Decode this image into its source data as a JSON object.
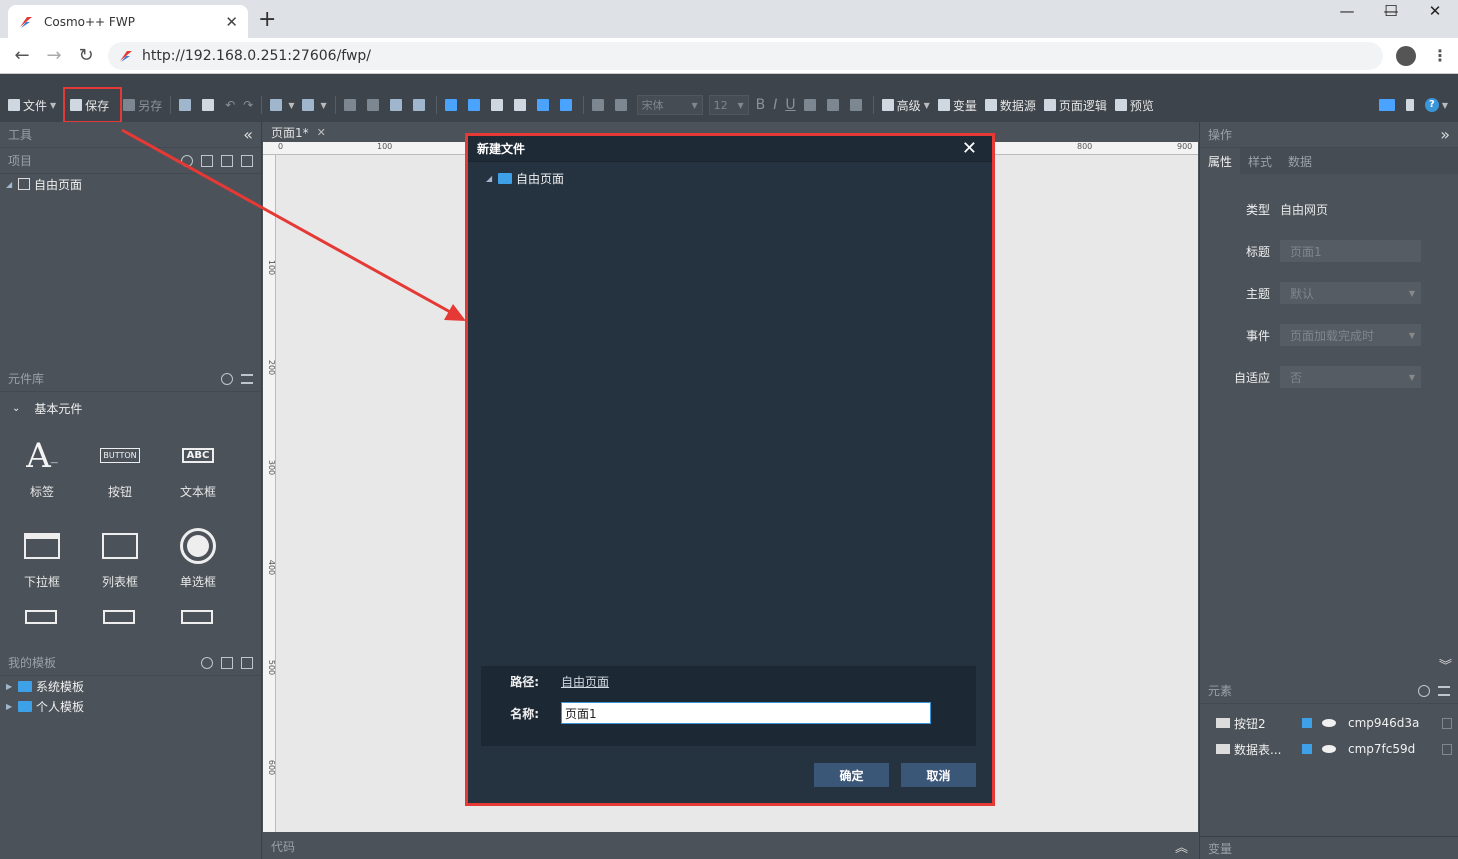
{
  "browser": {
    "tab_title": "Cosmo++ FWP",
    "tab_close": "✕",
    "new_tab": "+",
    "url": "http://192.168.0.251:27606/fwp/",
    "controls": {
      "minimize": "—",
      "maximize": "☐",
      "close": "✕"
    }
  },
  "toolbar": {
    "file": "文件",
    "save": "保存",
    "save_as": "另存",
    "font_family": "宋体",
    "font_size": "12",
    "bold": "B",
    "italic": "I",
    "underline": "U",
    "advanced": "高级",
    "variables": "变量",
    "datasource": "数据源",
    "page_logic": "页面逻辑",
    "preview": "预览",
    "help": "?"
  },
  "left": {
    "tools_title": "工具",
    "collapse": "«",
    "project_title": "项目",
    "project_root": "自由页面",
    "library_title": "元件库",
    "library_category": "基本元件",
    "components": [
      {
        "label": "标签",
        "icon": "label-icon",
        "glyph": "A"
      },
      {
        "label": "按钮",
        "icon": "button-icon",
        "glyph": "BUTTON"
      },
      {
        "label": "文本框",
        "icon": "textbox-icon",
        "glyph": "ABC"
      },
      {
        "label": "下拉框",
        "icon": "dropdown-icon",
        "glyph": ""
      },
      {
        "label": "列表框",
        "icon": "listbox-icon",
        "glyph": ""
      },
      {
        "label": "单选框",
        "icon": "radio-icon",
        "glyph": ""
      }
    ],
    "templates_title": "我的模板",
    "templates": [
      "系统模板",
      "个人模板"
    ]
  },
  "canvas": {
    "doc_tab": "页面1*",
    "doc_close": "✕",
    "ruler_h": [
      "0",
      "100",
      "800",
      "900"
    ],
    "ruler_v": [
      "100",
      "200",
      "300",
      "400",
      "500",
      "600"
    ],
    "code_label": "代码"
  },
  "right": {
    "ops_title": "操作",
    "tabs": [
      "属性",
      "样式",
      "数据"
    ],
    "props": {
      "type_label": "类型",
      "type_value": "自由网页",
      "title_label": "标题",
      "title_value": "页面1",
      "theme_label": "主题",
      "theme_value": "默认",
      "event_label": "事件",
      "event_value": "页面加载完成时",
      "adaptive_label": "自适应",
      "adaptive_value": "否"
    },
    "elements_title": "元素",
    "elements": [
      {
        "name": "按钮2",
        "id": "cmp946d3a"
      },
      {
        "name": "数据表...",
        "id": "cmp7fc59d"
      }
    ],
    "variables_title": "变量"
  },
  "dialog": {
    "title": "新建文件",
    "close": "✕",
    "tree_root": "自由页面",
    "path_label": "路径:",
    "path_value": "自由页面",
    "name_label": "名称:",
    "name_value": "页面1",
    "ok": "确定",
    "cancel": "取消"
  },
  "colors": {
    "highlight": "#e53935",
    "folder": "#3ea0e6",
    "dialog_bg": "#25323f",
    "button": "#3b5778"
  }
}
